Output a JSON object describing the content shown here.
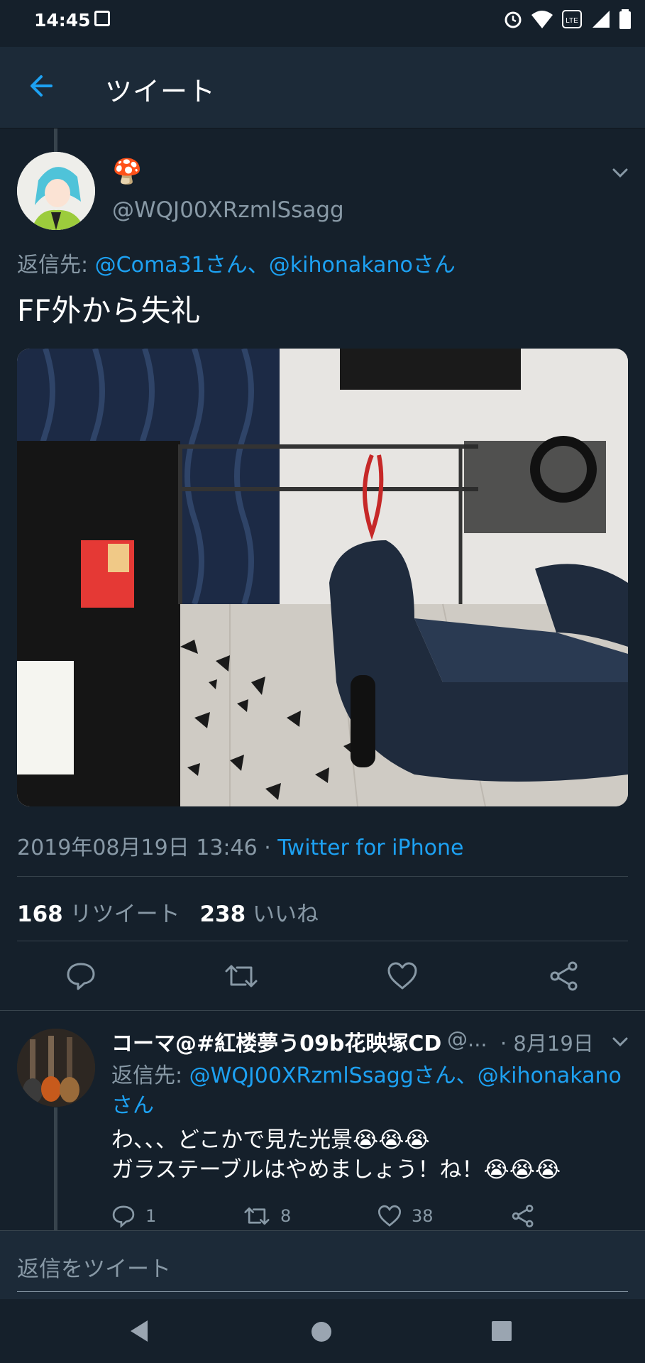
{
  "status_bar": {
    "time": "14:45"
  },
  "header": {
    "title": "ツイート"
  },
  "tweet": {
    "display_name_emoji": "🍄",
    "handle": "@WQJ00XRzmlSsagg",
    "reply_prefix": "返信先: ",
    "reply_to": "@Coma31さん、@kihonakanoさん",
    "text": "FF外から失礼",
    "timestamp": "2019年08月19日 13:46 · ",
    "source": "Twitter for iPhone",
    "retweet_count": "168",
    "retweet_label": " リツイート",
    "like_count": "238",
    "like_label": " いいね"
  },
  "reply": {
    "display_name": "コーマ@#紅楼夢う09b花映塚CD",
    "handle_truncated": "@...",
    "date": "· 8月19日",
    "reply_prefix": "返信先: ",
    "reply_to_line1": "@WQJ00XRzmlSsaggさん、@kihonakano",
    "reply_to_line2": "さん",
    "text_line1": "わ、、、どこかで見た光景😭😭😭",
    "text_line2": "ガラステーブルはやめましょう！ね！😭😭😭",
    "reply_count": "1",
    "retweet_count": "8",
    "like_count": "38"
  },
  "compose": {
    "placeholder": "返信をツイート"
  },
  "colors": {
    "background": "#15202b",
    "header": "#1c2a38",
    "accent": "#1da1f2",
    "muted": "#8899a6",
    "divider": "#38444d"
  }
}
